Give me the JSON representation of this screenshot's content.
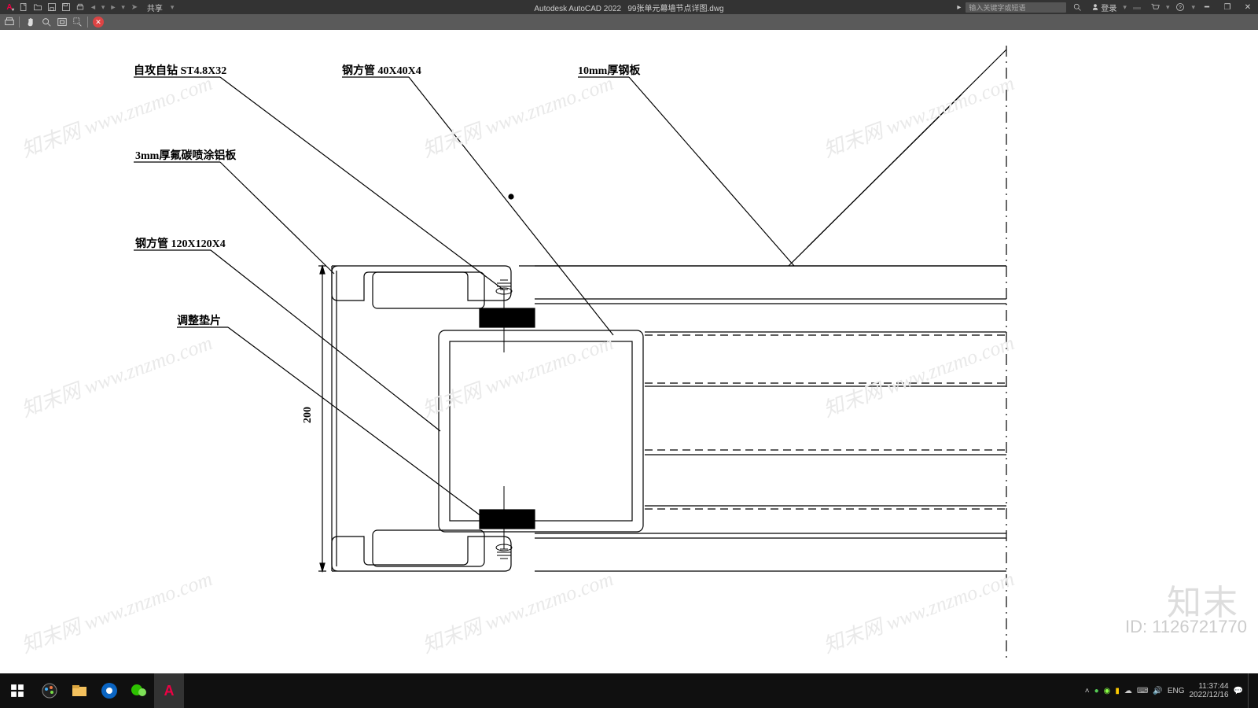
{
  "app": {
    "name": "Autodesk AutoCAD 2022",
    "file": "99张单元幕墙节点详图.dwg",
    "share": "共享"
  },
  "titlebar": {
    "search_placeholder": "输入关键字或短语",
    "login": "登录"
  },
  "labels": {
    "screw": "自攻自钻 ST4.8X32",
    "tube40": "钢方管 40X40X4",
    "plate10": "10mm厚钢板",
    "panel3": "3mm厚氟碳喷涂铝板",
    "tube120": "钢方管 120X120X4",
    "shim": "调整垫片",
    "dim200": "200"
  },
  "watermark": {
    "text": "知末网 www.znzmo.com",
    "logo": "知末",
    "id": "ID: 1126721770"
  },
  "tray": {
    "ime": "ENG",
    "time": "11:37:44",
    "date": "2022/12/16"
  }
}
